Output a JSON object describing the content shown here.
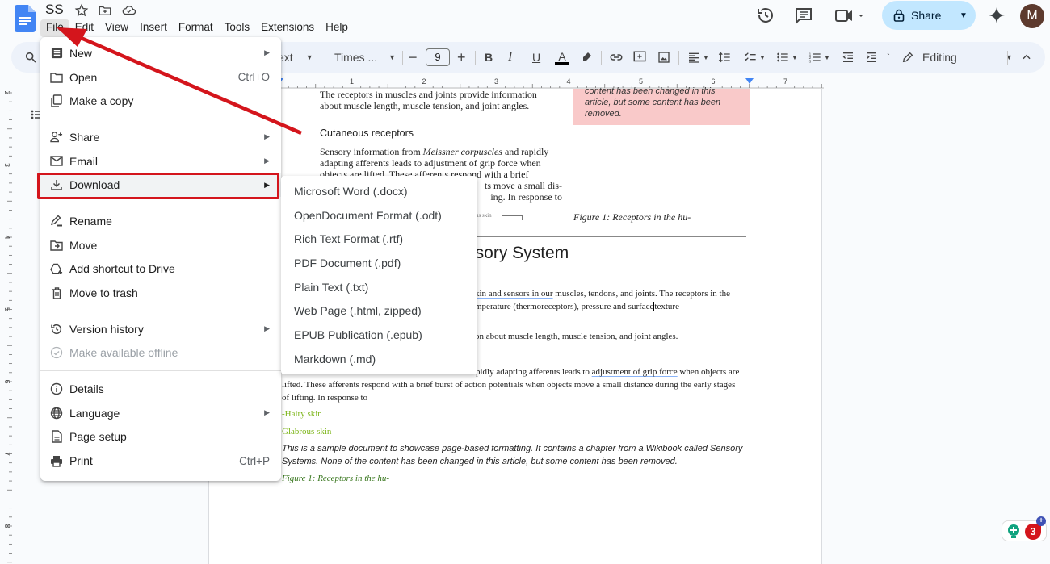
{
  "app": {
    "doc_title": "SS",
    "menu": [
      "File",
      "Edit",
      "View",
      "Insert",
      "Format",
      "Tools",
      "Extensions",
      "Help"
    ],
    "active_menu": "File"
  },
  "header": {
    "share_label": "Share",
    "avatar_initial": "M",
    "icons": [
      "star-icon",
      "move-folder-icon",
      "cloud-saved-icon",
      "version-history-icon",
      "comments-icon",
      "meet-icon",
      "gemini-icon"
    ]
  },
  "toolbar": {
    "style_label": "ext",
    "font_label": "Times ...",
    "font_size": "9",
    "decrease": "−",
    "increase": "+",
    "bold": "B",
    "italic": "I",
    "underline": "U",
    "text_color": "A",
    "mode_label": "Editing"
  },
  "ruler": {
    "h_ticks": [
      "1",
      "2",
      "3",
      "4",
      "5",
      "6",
      "7"
    ],
    "v_ticks": [
      "2",
      "3",
      "4",
      "5",
      "6",
      "7",
      "8"
    ]
  },
  "file_menu": {
    "groups": [
      [
        {
          "label": "New",
          "icon": "doc-icon",
          "submenu": true
        },
        {
          "label": "Open",
          "icon": "folder-icon",
          "shortcut": "Ctrl+O"
        },
        {
          "label": "Make a copy",
          "icon": "copy-icon"
        }
      ],
      [
        {
          "label": "Share",
          "icon": "person-add-icon",
          "submenu": true
        },
        {
          "label": "Email",
          "icon": "mail-icon",
          "submenu": true
        },
        {
          "label": "Download",
          "icon": "download-icon",
          "submenu": true,
          "highlighted": true
        }
      ],
      [
        {
          "label": "Rename",
          "icon": "rename-icon"
        },
        {
          "label": "Move",
          "icon": "move-folder-icon"
        },
        {
          "label": "Add shortcut to Drive",
          "icon": "drive-shortcut-icon"
        },
        {
          "label": "Move to trash",
          "icon": "trash-icon"
        }
      ],
      [
        {
          "label": "Version history",
          "icon": "history-icon",
          "submenu": true
        },
        {
          "label": "Make available offline",
          "icon": "offline-check-icon",
          "disabled": true
        }
      ],
      [
        {
          "label": "Details",
          "icon": "info-icon"
        },
        {
          "label": "Language",
          "icon": "globe-icon",
          "submenu": true
        },
        {
          "label": "Page setup",
          "icon": "page-icon"
        },
        {
          "label": "Print",
          "icon": "print-icon",
          "shortcut": "Ctrl+P"
        }
      ]
    ]
  },
  "download_menu": {
    "items": [
      "Microsoft Word (.docx)",
      "OpenDocument Format (.odt)",
      "Rich Text Format (.rtf)",
      "PDF Document (.pdf)",
      "Plain Text (.txt)",
      "Web Page (.html, zipped)",
      "EPUB Publication (.epub)",
      "Markdown (.md)"
    ]
  },
  "document": {
    "p1_line1": "The receptors in muscles and joints provide information",
    "p1_line2": "about muscle length, muscle   tension, and joint angles.",
    "heading_cutaneous": "Cutaneous receptors",
    "p2_line1_a": "Sensory information from ",
    "p2_line1_i": "Meissner corpuscles",
    "p2_line1_b": " and rapidly",
    "p2_line2": "adapting afferents leads to adjustment of grip force when",
    "p2_line3": "objects are lifted. These afferents respond with a brief",
    "p2_line4": "ts move a small dis-",
    "p2_line5": "ing. In response to",
    "fig_label_small": "us skin",
    "callout_line1": "content has been changed in this",
    "callout_line2": "article, but some content has been",
    "callout_line3": "removed.",
    "figure_caption": "Figure 1:   Receptors  in  the  hu-",
    "title_fragment": "nsory System",
    "b1_l1_ul": "kin and sensors in our",
    "b1_l1_rest": " muscles, tendons, and joints. The receptors in the",
    "b1_l2": "mperature (thermoreceptors), pressure and surface",
    "b1_l2_b": "texture",
    "b2": "on about muscle length, muscle tension, and joint angles.",
    "b3_l1_a": "pidly adapting afferents leads to ",
    "b3_l1_ul": "adjustment of grip force",
    "b3_l1_b": " when objects are",
    "b3_l2": "lifted. These afferents respond with a brief burst of action potentials when objects move a small distance during the early stages",
    "b3_l3": "of lifting. In response to",
    "hairy": "-Hairy skin",
    "glabrous": "Glabrous skin",
    "sample_l1": "This is a sample document to showcase page-based formatting. It contains a chapter from a Wikibook called Sensory",
    "sample_l2_a": "Systems. ",
    "sample_l2_ul": "None of the content has been changed in this article",
    "sample_l2_b": ", but some ",
    "sample_l2_ul2": "content",
    "sample_l2_c": " has been removed.",
    "fig_green": "Figure 1: Receptors in the hu-"
  },
  "extension_badge": {
    "count": "3"
  },
  "colors": {
    "accent_blue": "#1a73e8",
    "share_bg": "#c2e7ff",
    "annotation_red": "#d4151c",
    "callout_pink": "#f9c9c9",
    "green_text": "#7cb518",
    "dark_green_text": "#38761d"
  }
}
